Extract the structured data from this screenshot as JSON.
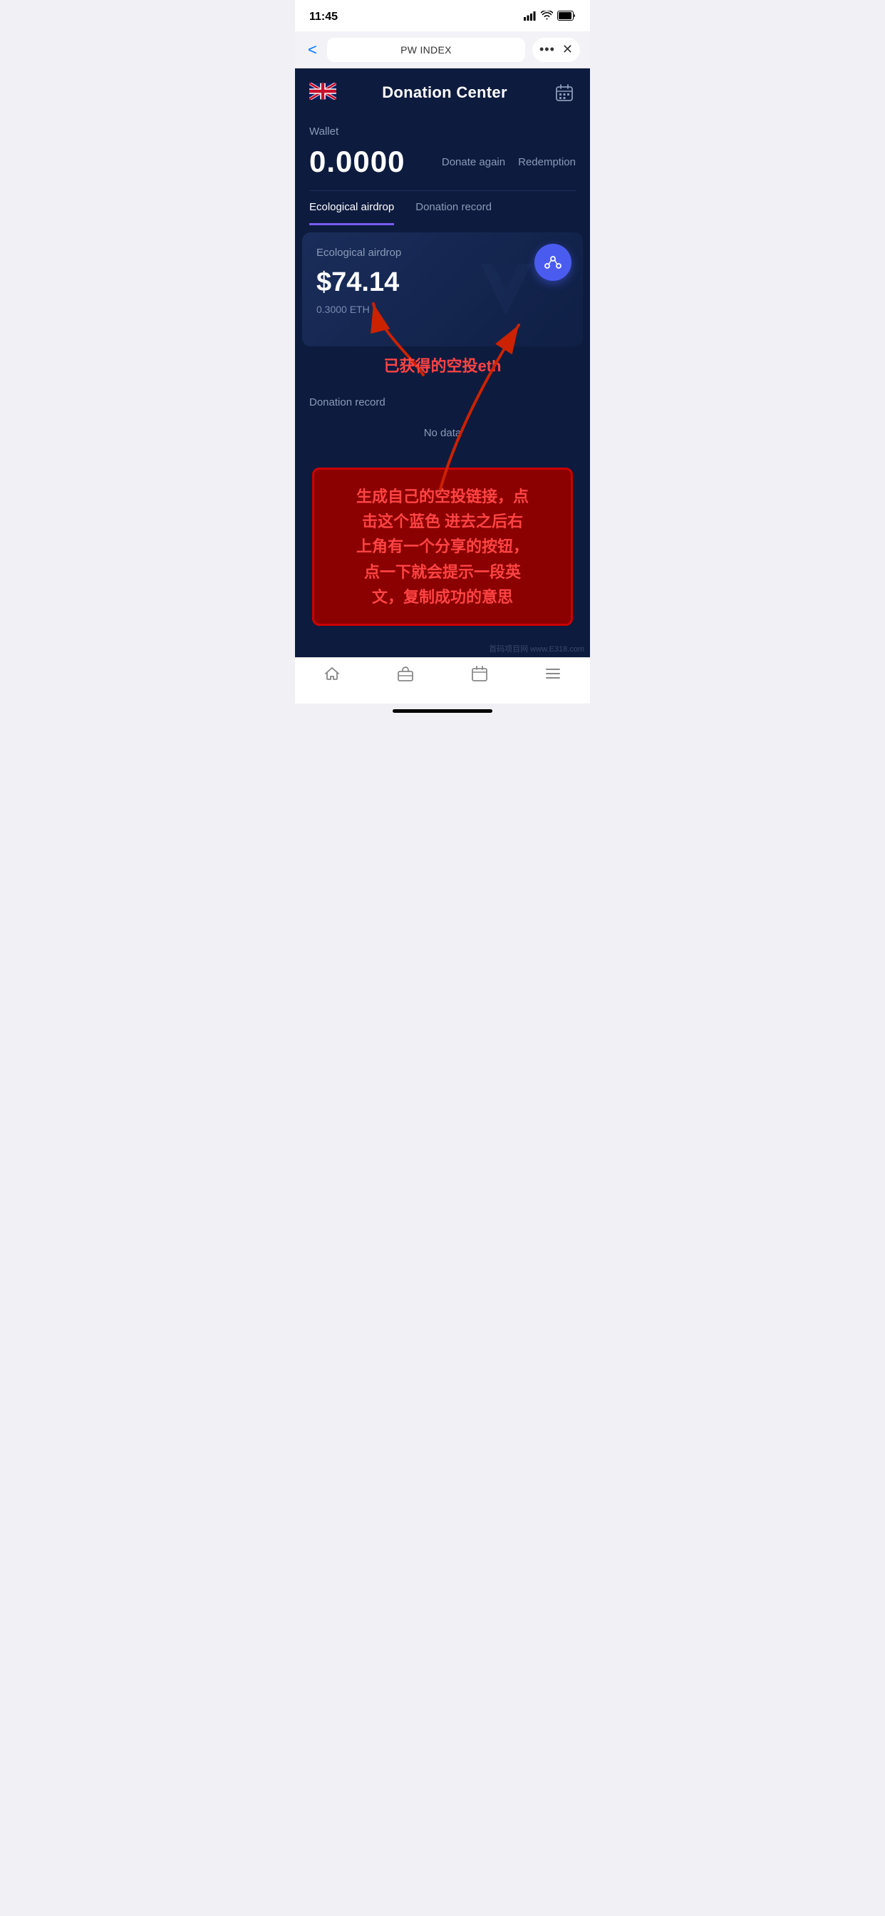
{
  "status_bar": {
    "time": "11:45",
    "signal": "▂▄▆█",
    "wifi": "WiFi",
    "battery": "Battery"
  },
  "browser_nav": {
    "back_label": "<",
    "title": "PW INDEX",
    "dots_label": "•••",
    "close_label": "✕"
  },
  "app_header": {
    "title": "Donation Center",
    "calendar_icon": "🗓"
  },
  "wallet": {
    "label": "Wallet",
    "amount": "0.0000",
    "donate_again": "Donate again",
    "redemption": "Redemption"
  },
  "tabs": [
    {
      "label": "Ecological airdrop",
      "active": true
    },
    {
      "label": "Donation record",
      "active": false
    }
  ],
  "airdrop_card": {
    "label": "Ecological airdrop",
    "amount": "$74.14",
    "eth_amount": "0.3000 ETH",
    "share_icon": "share"
  },
  "donation_record": {
    "label": "Donation record",
    "no_data": "No data"
  },
  "annotation": {
    "chinese_floating": "已获得的空投eth",
    "red_box_text": "生成自己的空投链接，点\n击这个蓝色 进去之后右\n上角有一个分享的按钮，\n点一下就会提示一段英\n文，复制成功的意思"
  },
  "bottom_nav": {
    "items": [
      {
        "icon": "home",
        "label": "Home"
      },
      {
        "icon": "briefcase",
        "label": "Portfolio"
      },
      {
        "icon": "calendar",
        "label": "Calendar"
      },
      {
        "icon": "menu",
        "label": "Menu"
      }
    ]
  },
  "watermark": "首码项目网 www.E318.com"
}
